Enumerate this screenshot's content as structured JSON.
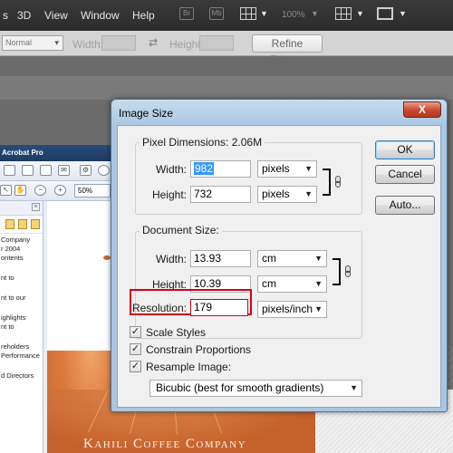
{
  "menubar": {
    "items": [
      "s",
      "3D",
      "View",
      "Window",
      "Help"
    ],
    "icon_labels": [
      "Br",
      "Mb"
    ],
    "zoom": "100%"
  },
  "options_bar": {
    "style": "Normal",
    "width_label": "Width:",
    "height_label": "Height:",
    "refine_edge": "Refine Edge..."
  },
  "acrobat": {
    "title": "Acrobat Pro",
    "zoom": "50%",
    "nav_lines": [
      "Company",
      "r 2004",
      "ontents",
      "",
      "nt to",
      "",
      "nt to our",
      "",
      "ighlights",
      "nt to",
      "",
      "reholders",
      "Performance",
      "",
      "d Directors"
    ]
  },
  "document": {
    "brand": "Kahili Coffee Company"
  },
  "dialog": {
    "title": "Image Size",
    "close": "X",
    "pixel_dimensions": {
      "label": "Pixel Dimensions:",
      "size": "2.06M",
      "width_label": "Width:",
      "width_value": "982",
      "width_unit": "pixels",
      "height_label": "Height:",
      "height_value": "732",
      "height_unit": "pixels"
    },
    "document_size": {
      "label": "Document Size:",
      "width_label": "Width:",
      "width_value": "13.93",
      "width_unit": "cm",
      "height_label": "Height:",
      "height_value": "10.39",
      "height_unit": "cm",
      "resolution_label": "Resolution:",
      "resolution_value": "179",
      "resolution_unit": "pixels/inch"
    },
    "options": {
      "scale_styles": "Scale Styles",
      "constrain_proportions": "Constrain Proportions",
      "resample_image": "Resample Image:",
      "check_mark": "✓",
      "resample_method": "Bicubic (best for smooth gradients)"
    },
    "buttons": {
      "ok": "OK",
      "cancel": "Cancel",
      "auto": "Auto..."
    }
  },
  "colors": {
    "highlight": "#d4001a",
    "selection": "#3399ff"
  }
}
